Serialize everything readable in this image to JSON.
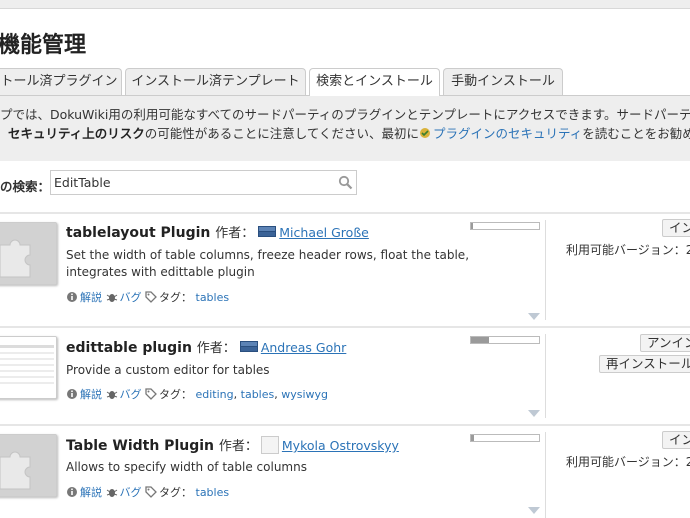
{
  "page": {
    "title": "機能管理"
  },
  "tabs": [
    {
      "label": "トール済プラグイン",
      "active": false
    },
    {
      "label": "インストール済テンプレート",
      "active": false
    },
    {
      "label": "検索とインストール",
      "active": true
    },
    {
      "label": "手動インストール",
      "active": false
    }
  ],
  "intro": {
    "line1": "プでは、DokuWiki用の利用可能なすべてのサードパーティのプラグインとテンプレートにアクセスできます。サードパーティ製",
    "line2_bold": "セキュリティ上のリスク",
    "line2_mid": "の可能性があることに注意してください、最初に",
    "line2_link": "プラグインのセキュリティ",
    "line2_end": "を読むことをお勧めし"
  },
  "search": {
    "label": "の検索：",
    "value": "EditTable",
    "icon": "search-icon"
  },
  "plugins": [
    {
      "name": "tablelayout Plugin",
      "by": "作者：",
      "author": "Michael Große",
      "author_badge": "COSMO CODE",
      "description": "Set the width of table columns, freeze header rows, float the table, integrates with edittable plugin",
      "docs": "解説",
      "bugs": "バグ",
      "tags_label": "タグ：",
      "tags": [
        "tables"
      ],
      "popularity": 0.03,
      "buttons": [
        "インストール"
      ],
      "available_version_label": "利用可能バージョン：",
      "available_version": "2"
    },
    {
      "name": "edittable plugin",
      "by": "作者：",
      "author": "Andreas Gohr",
      "author_badge": "COSMO CODE",
      "description": "Provide a custom editor for tables",
      "docs": "解説",
      "bugs": "バグ",
      "tags_label": "タグ：",
      "tags": [
        "editing",
        "tables",
        "wysiwyg"
      ],
      "popularity": 0.27,
      "buttons": [
        "アンインストール",
        "再インストール"
      ],
      "available_version_label": "",
      "available_version": ""
    },
    {
      "name": "Table Width Plugin",
      "by": "作者：",
      "author": "Mykola Ostrovskyy",
      "author_badge": "",
      "description": "Allows to specify width of table columns",
      "docs": "解説",
      "bugs": "バグ",
      "tags_label": "タグ：",
      "tags": [
        "tables"
      ],
      "popularity": 0.05,
      "buttons": [
        "インストール"
      ],
      "available_version_label": "利用可能バージョン：",
      "available_version": "2"
    }
  ],
  "colors": {
    "link": "#2b73b7",
    "panel": "#eeeeee",
    "tab_inactive": "#eeeeee"
  }
}
